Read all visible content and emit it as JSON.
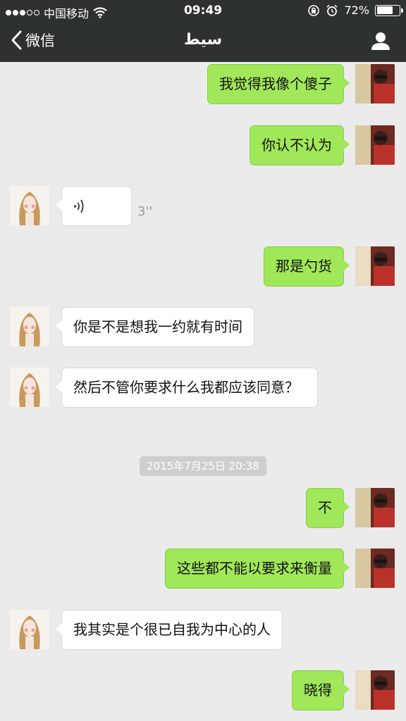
{
  "status_bar": {
    "carrier": "中国移动",
    "time": "09:49",
    "battery": "72%",
    "battery_level": 0.72
  },
  "nav": {
    "back_label": "微信",
    "title": "سيط"
  },
  "messages": [
    {
      "from": "me",
      "text": "我觉得我像个傻子"
    },
    {
      "from": "me",
      "text": "你认不认为"
    },
    {
      "from": "other",
      "type": "voice",
      "duration": "3''"
    },
    {
      "from": "me",
      "text": "那是勺货"
    },
    {
      "from": "other",
      "text": "你是不是想我一约就有时间"
    },
    {
      "from": "other",
      "text": "然后不管你要求什么我都应该同意？"
    },
    {
      "from": "me",
      "text": "不"
    },
    {
      "from": "me",
      "text": "这些都不能以要求来衡量"
    },
    {
      "from": "other",
      "text": "我其实是个很已自我为中心的人"
    },
    {
      "from": "me",
      "text": "晓得"
    }
  ],
  "timestamp": "2015年7月25日 20:38",
  "colors": {
    "nav_bg": "#2e3132",
    "sent_bubble": "#a0e759",
    "received_bubble": "#ffffff",
    "chat_bg": "#ebebeb"
  }
}
